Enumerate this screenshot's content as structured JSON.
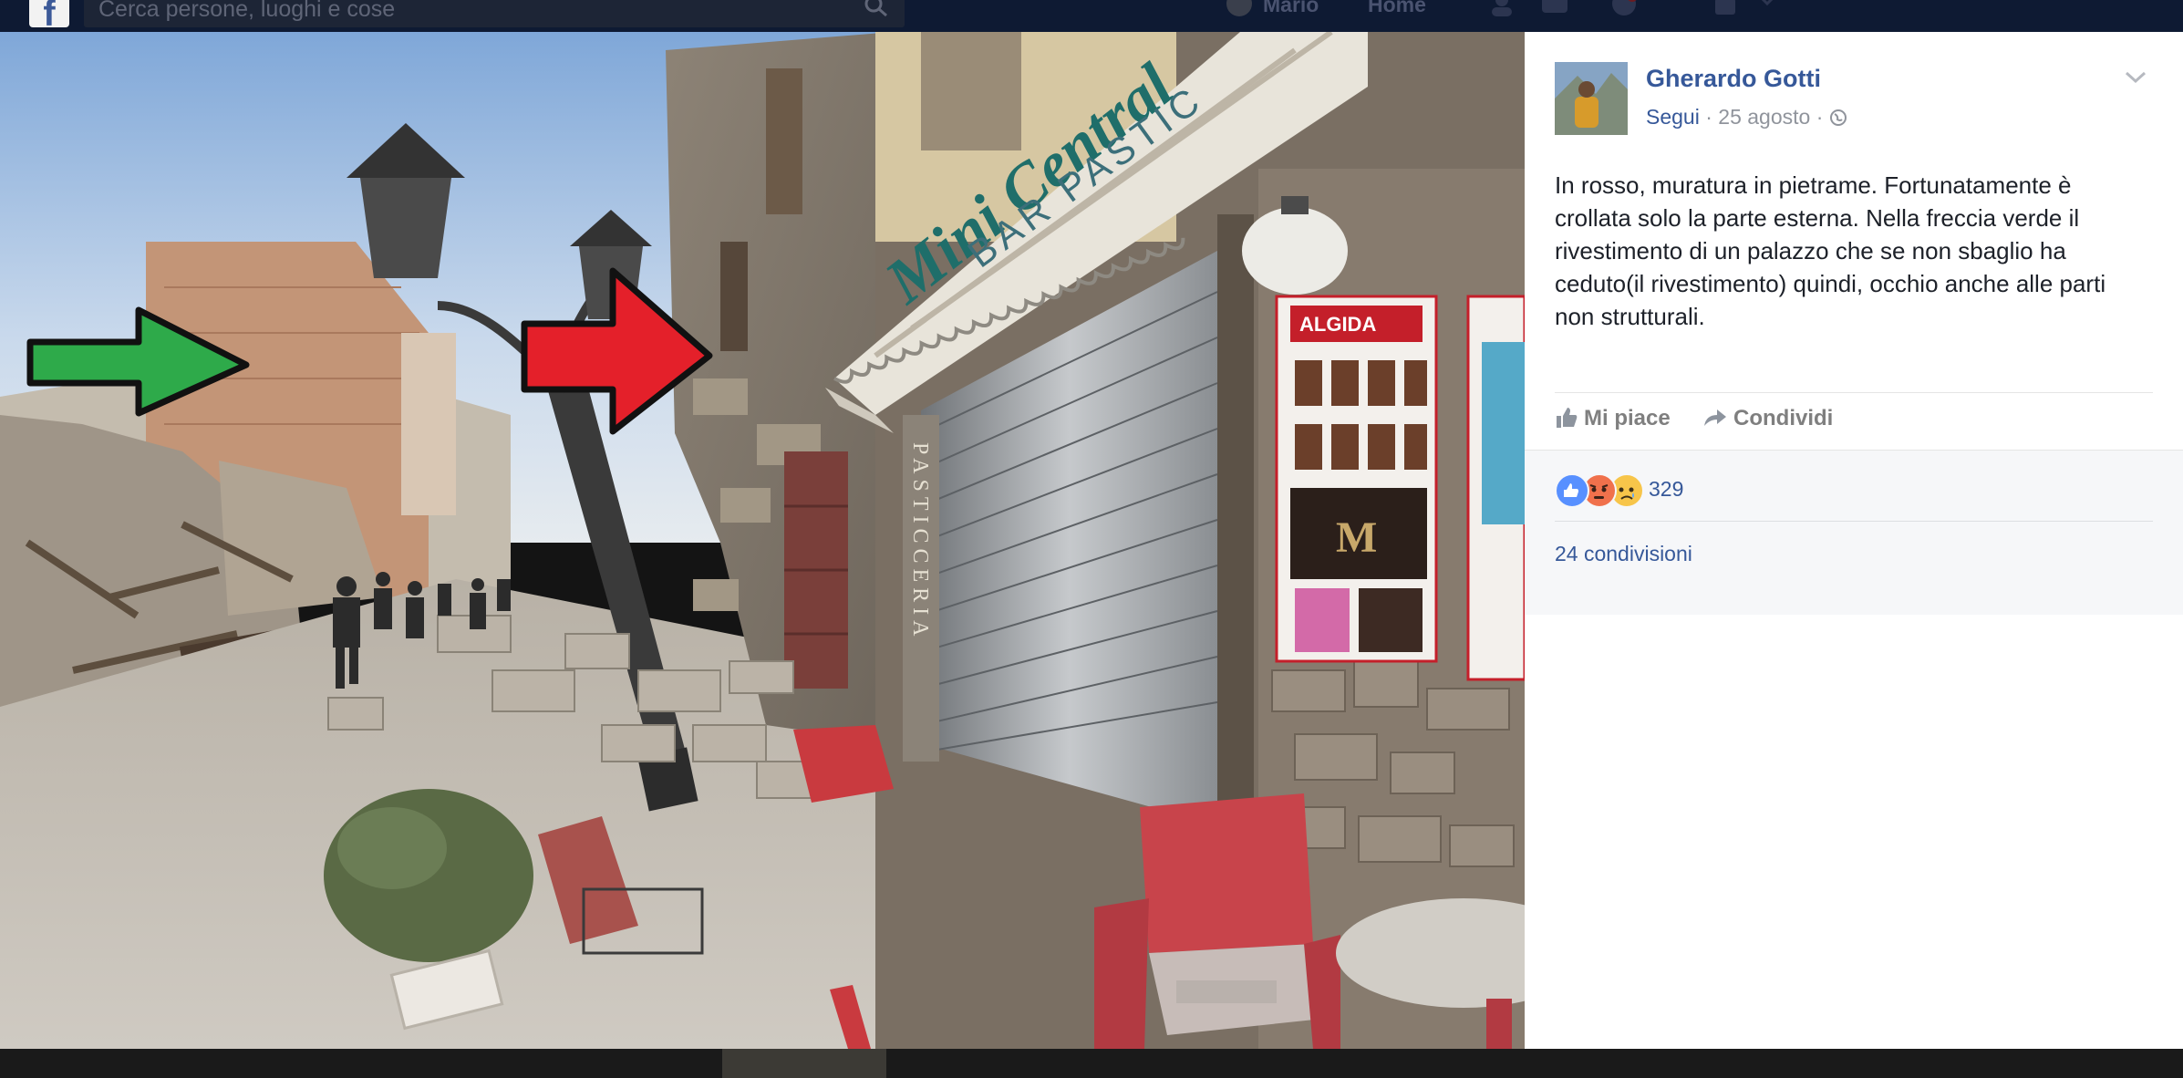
{
  "topbar": {
    "search_placeholder": "Cerca persone, luoghi e cose",
    "user_name": "Mario",
    "home_label": "Home"
  },
  "photo": {
    "shop_sign": "Mini Central",
    "awning_words": "BAR  PASTIC",
    "vertical_sign": "PASTICCERIA",
    "poster_text": "ALGIDA",
    "poster_brand": "M",
    "arrow_left_color": "#2eaa4a",
    "arrow_right_color": "#e4202a"
  },
  "post": {
    "author": "Gherardo Gotti",
    "follow_label": "Segui",
    "date": "25 agosto",
    "separator": "·",
    "text": "In rosso, muratura in pietrame. Fortunatamente è\ncrollata solo la parte esterna. Nella freccia verde il\nrivestimento di un palazzo che se non sbaglio ha\nceduto(il rivestimento) quindi, occhio anche alle parti\nnon strutturali.",
    "like_label": "Mi piace",
    "share_label": "Condividi",
    "reaction_count": "329",
    "shares_label": "24 condivisioni",
    "reactions": [
      "like-reaction",
      "angry-reaction",
      "sad-reaction"
    ],
    "colors": {
      "link": "#365899",
      "like": "#5890ff",
      "angry": "#f0714c",
      "sad": "#f7c54a"
    }
  }
}
